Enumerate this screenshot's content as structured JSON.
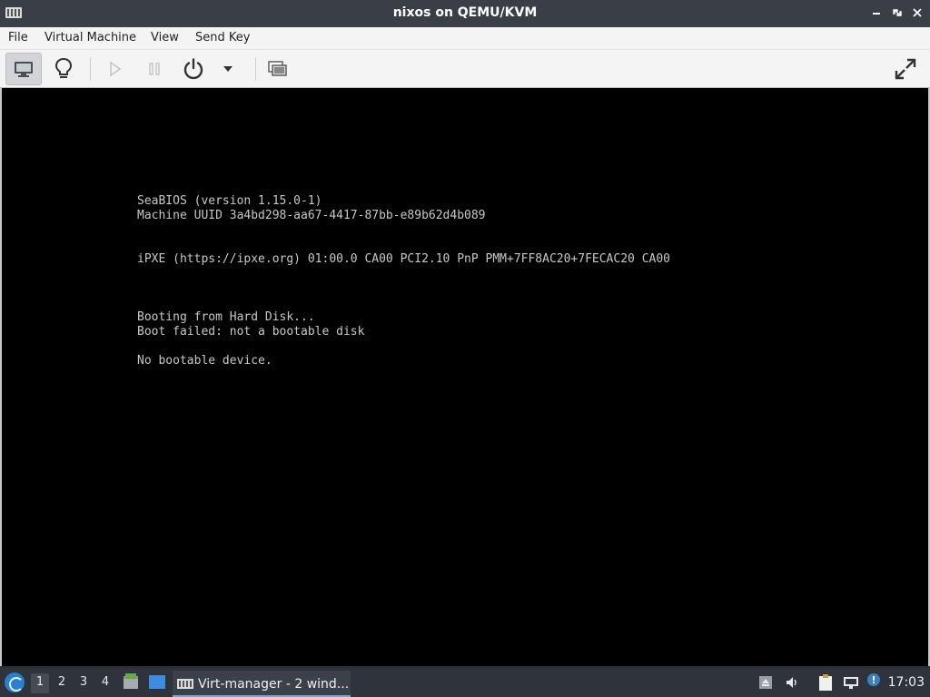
{
  "window": {
    "title": "nixos on QEMU/KVM",
    "app_icon": "virt-manager-icon",
    "controls": {
      "minimize": "–",
      "maximize": "⤢",
      "close": "✕"
    }
  },
  "menubar": {
    "items": [
      {
        "label": "File"
      },
      {
        "label": "Virtual Machine"
      },
      {
        "label": "View"
      },
      {
        "label": "Send Key"
      }
    ]
  },
  "toolbar": {
    "buttons": [
      {
        "icon": "monitor-icon",
        "state": "active"
      },
      {
        "icon": "lightbulb-icon",
        "state": "normal"
      },
      {
        "icon": "play-icon",
        "state": "disabled"
      },
      {
        "icon": "pause-icon",
        "state": "disabled"
      },
      {
        "icon": "power-icon",
        "state": "normal"
      },
      {
        "icon": "chevron-down-icon",
        "state": "normal"
      },
      {
        "icon": "snapshots-icon",
        "state": "normal"
      },
      {
        "icon": "fullscreen-icon",
        "state": "normal"
      }
    ]
  },
  "console": {
    "lines": [
      "SeaBIOS (version 1.15.0-1)",
      "Machine UUID 3a4bd298-aa67-4417-87bb-e89b62d4b089",
      "iPXE (https://ipxe.org) 01:00.0 CA00 PCI2.10 PnP PMM+7FF8AC20+7FECAC20 CA00",
      "Booting from Hard Disk...",
      "Boot failed: not a bootable disk",
      "No bootable device."
    ],
    "text_color": "#c8c8c8",
    "background": "#000000"
  },
  "taskbar": {
    "workspaces": [
      "1",
      "2",
      "3",
      "4"
    ],
    "active_workspace": "1",
    "task_label": "Virt-manager - 2 wind...",
    "clock": "17:03",
    "tray_icons": [
      "eject-icon",
      "volume-icon",
      "clipboard-icon",
      "network-icon"
    ],
    "launchers": [
      "file-manager-icon",
      "desktop-icon"
    ]
  }
}
